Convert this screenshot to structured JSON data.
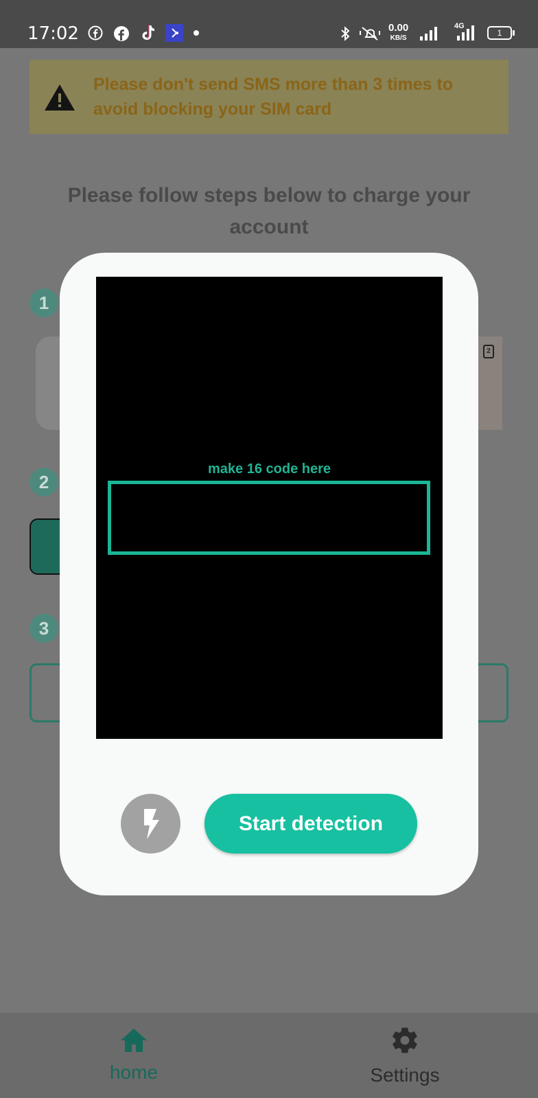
{
  "status_bar": {
    "time": "17:02",
    "net_speed_value": "0.00",
    "net_speed_unit": "KB/S",
    "network_type": "4G",
    "battery_text": "1"
  },
  "warning": {
    "text": "Please don't send SMS more than 3 times to avoid blocking your SIM card",
    "icon": "warning-icon"
  },
  "main": {
    "heading": "Please follow steps below to charge your account",
    "steps": [
      "1",
      "2",
      "3"
    ]
  },
  "modal": {
    "scan_label": "make 16 code here",
    "flash_icon": "flash-icon",
    "start_button": "Start detection"
  },
  "nav": {
    "home_label": "home",
    "settings_label": "Settings"
  },
  "colors": {
    "accent": "#17c0a0",
    "scan_frame": "#1ab695",
    "modal_bg": "#f8fafa",
    "overlay": "#777777"
  }
}
